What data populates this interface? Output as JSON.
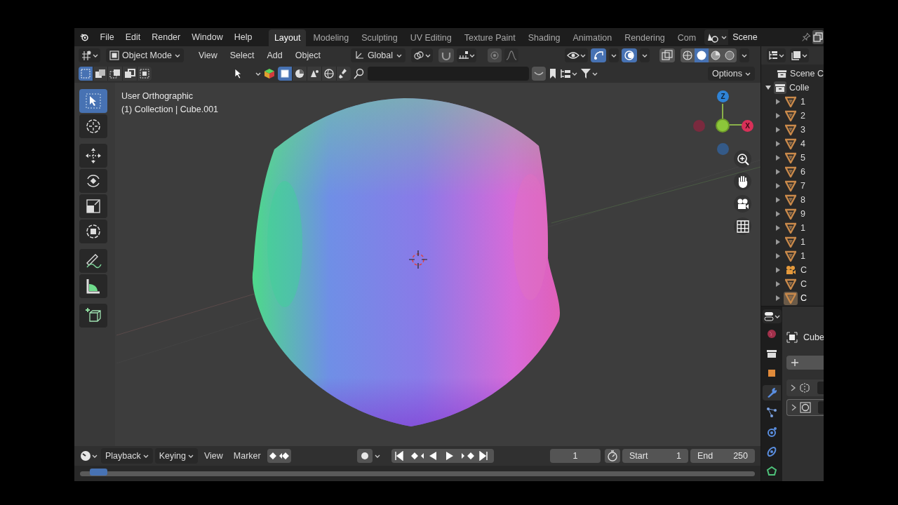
{
  "menu": [
    "File",
    "Edit",
    "Render",
    "Window",
    "Help"
  ],
  "workspaces": [
    {
      "label": "Layout",
      "selected": true
    },
    {
      "label": "Modeling",
      "selected": false
    },
    {
      "label": "Sculpting",
      "selected": false
    },
    {
      "label": "UV Editing",
      "selected": false
    },
    {
      "label": "Texture Paint",
      "selected": false
    },
    {
      "label": "Shading",
      "selected": false
    },
    {
      "label": "Animation",
      "selected": false
    },
    {
      "label": "Rendering",
      "selected": false
    },
    {
      "label": "Com",
      "selected": false
    }
  ],
  "scene": "Scene",
  "header": {
    "mode": "Object Mode",
    "menus": [
      "View",
      "Select",
      "Add",
      "Object"
    ],
    "orientation": "Global",
    "gizmos_on": true,
    "overlays_on": true,
    "shading": [
      {
        "kind": "wireframe",
        "selected": false
      },
      {
        "kind": "solid",
        "selected": true
      },
      {
        "kind": "material",
        "selected": false
      },
      {
        "kind": "rendered",
        "selected": false
      }
    ]
  },
  "tool_header": {
    "select_modes": [
      {
        "kind": "set",
        "selected": true
      },
      {
        "kind": "extend",
        "selected": false
      },
      {
        "kind": "subtract",
        "selected": false
      },
      {
        "kind": "invert",
        "selected": false
      },
      {
        "kind": "intersect",
        "selected": false
      }
    ],
    "options": "Options"
  },
  "viewport": {
    "view_name": "User Orthographic",
    "context": "(1) Collection | Cube.001",
    "gizmo_z": "Z",
    "gizmo_x": "X"
  },
  "toolbar": [
    {
      "kind": "select",
      "selected": true
    },
    {
      "kind": "cursor",
      "selected": false
    },
    {
      "kind": "move",
      "selected": false
    },
    {
      "kind": "rotate",
      "selected": false
    },
    {
      "kind": "scale",
      "selected": false
    },
    {
      "kind": "transform",
      "selected": false
    },
    {
      "kind": "annotate",
      "selected": false
    },
    {
      "kind": "measure",
      "selected": false
    },
    {
      "kind": "add_cube",
      "selected": false
    }
  ],
  "outliner": {
    "label": "Scene C",
    "children": [
      {
        "label": "Colle",
        "expanded": true,
        "children": [
          {
            "label": "1",
            "kind": "mesh",
            "selected": false
          },
          {
            "label": "2",
            "kind": "mesh",
            "selected": false
          },
          {
            "label": "3",
            "kind": "mesh",
            "selected": false
          },
          {
            "label": "4",
            "kind": "mesh",
            "selected": false
          },
          {
            "label": "5",
            "kind": "mesh",
            "selected": false
          },
          {
            "label": "6",
            "kind": "mesh",
            "selected": false
          },
          {
            "label": "7",
            "kind": "mesh",
            "selected": false
          },
          {
            "label": "8",
            "kind": "mesh",
            "selected": false
          },
          {
            "label": "9",
            "kind": "mesh",
            "selected": false
          },
          {
            "label": "1",
            "kind": "mesh",
            "selected": false
          },
          {
            "label": "1",
            "kind": "mesh",
            "selected": false
          },
          {
            "label": "1",
            "kind": "mesh",
            "selected": false
          },
          {
            "label": "C",
            "kind": "camera",
            "selected": false
          },
          {
            "label": "C",
            "kind": "mesh",
            "selected": false
          },
          {
            "label": "C",
            "kind": "mesh",
            "selected": true
          }
        ]
      }
    ]
  },
  "properties": {
    "object": "Cube",
    "tabs": [
      {
        "kind": "world",
        "selected": false
      },
      {
        "kind": "collection",
        "selected": false
      },
      {
        "kind": "object",
        "selected": false
      },
      {
        "kind": "modifier",
        "selected": true
      },
      {
        "kind": "particles",
        "selected": false
      },
      {
        "kind": "physics",
        "selected": false
      },
      {
        "kind": "constraints",
        "selected": false
      },
      {
        "kind": "data",
        "selected": false
      }
    ],
    "modifiers": [
      {
        "kind": "mirror",
        "selected": false
      },
      {
        "kind": "subdivision",
        "selected": true
      }
    ]
  },
  "timeline": {
    "menus": [
      "Playback",
      "Keying",
      "View",
      "Marker"
    ],
    "current_frame": "1",
    "start_label": "Start",
    "start": "1",
    "end_label": "End",
    "end": "250"
  }
}
